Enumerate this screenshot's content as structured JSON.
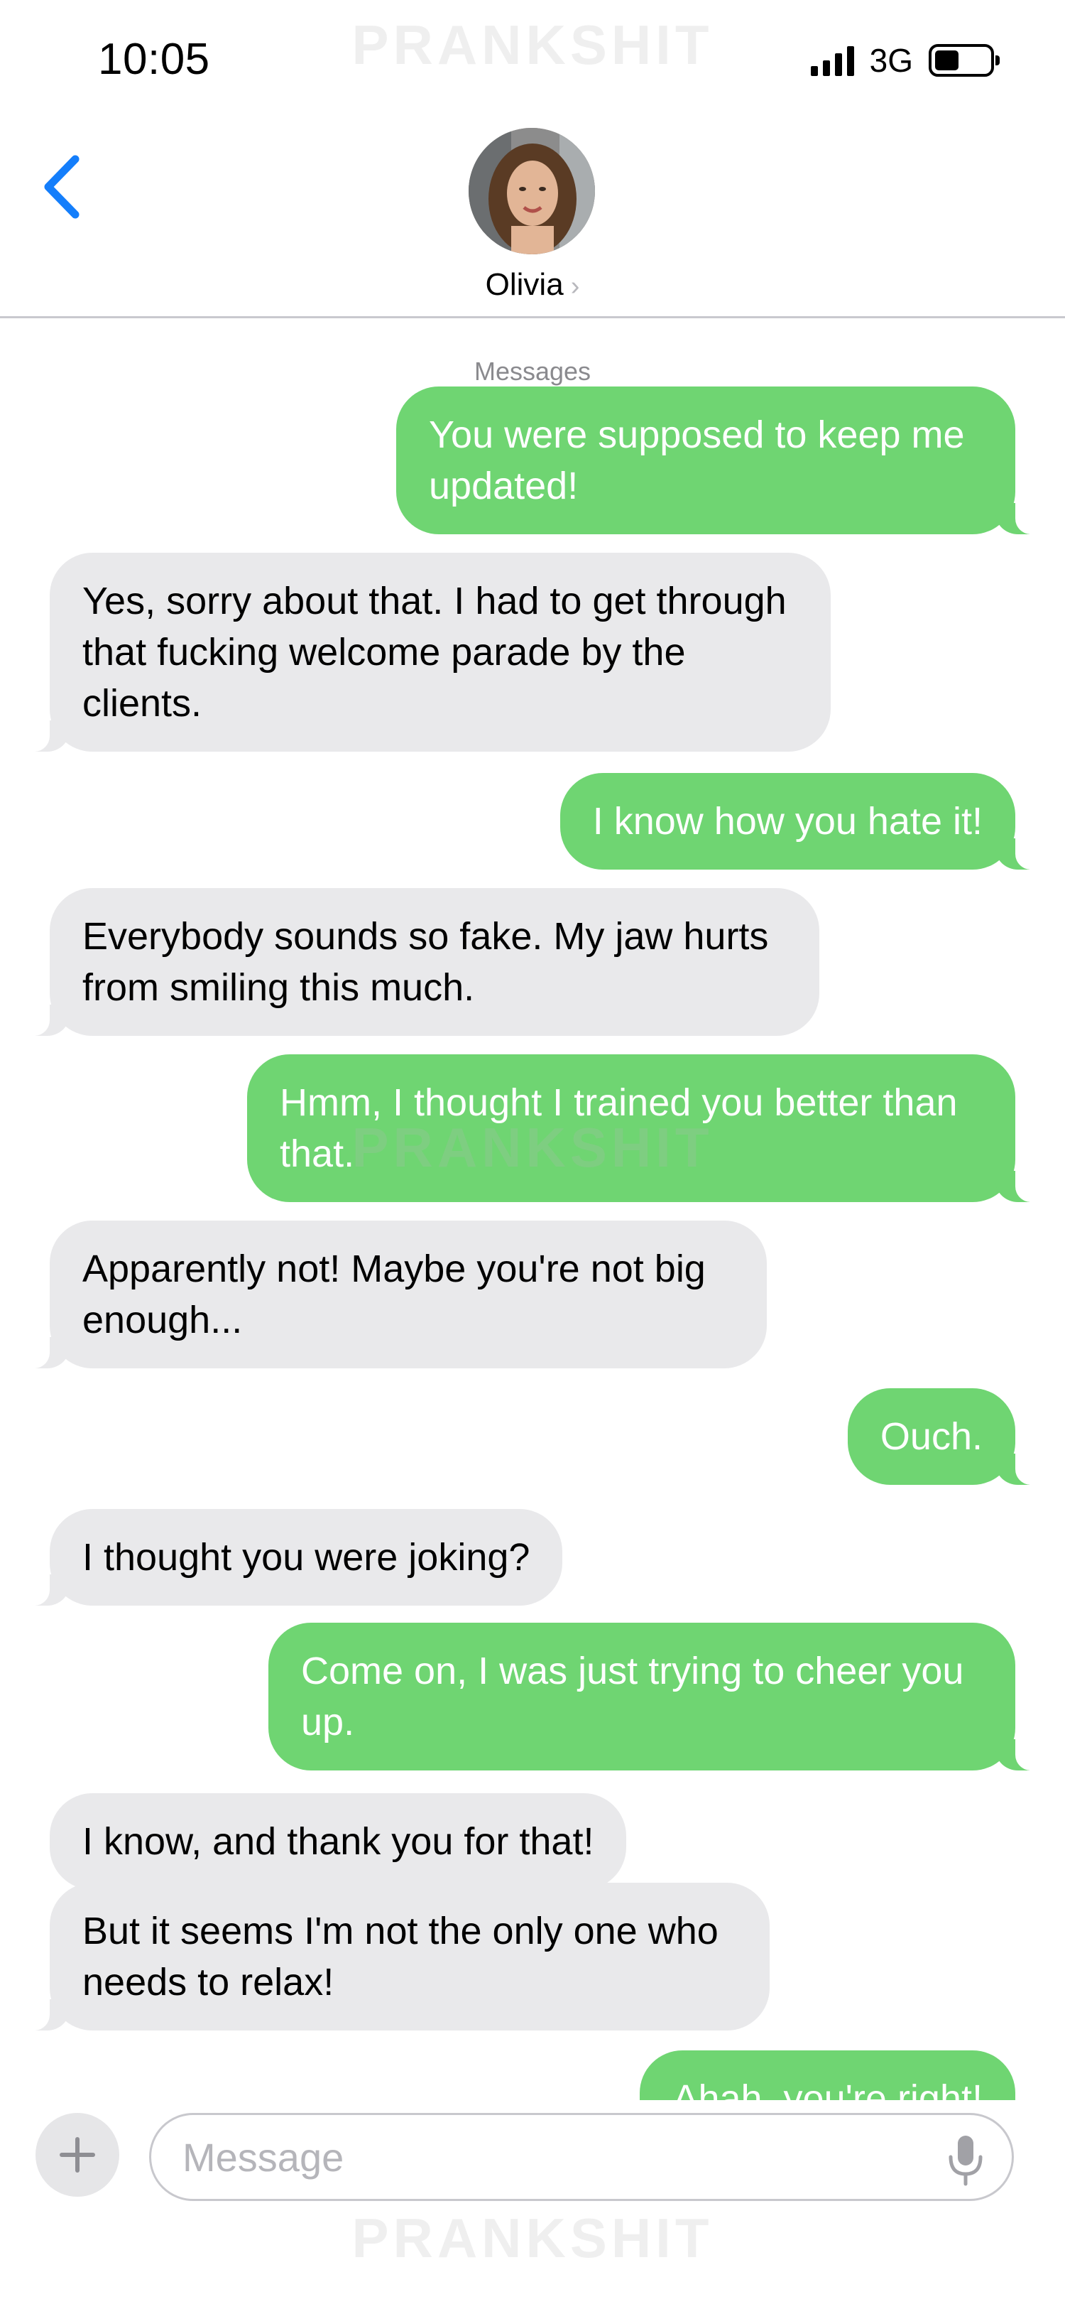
{
  "status_bar": {
    "time": "10:05",
    "network": "3G",
    "battery_level": 0.44
  },
  "watermark": "PRANKSHIT",
  "header": {
    "contact_name": "Olivia",
    "back_icon": "chevron-left-icon",
    "name_chevron": "›"
  },
  "chat": {
    "service_label": "Messages",
    "messages": [
      {
        "from": "me",
        "text": "You were supposed to keep me updated!"
      },
      {
        "from": "them",
        "text": "Yes, sorry about that. I had to get through that fucking welcome parade by the clients."
      },
      {
        "from": "me",
        "text": "I know how you hate it!"
      },
      {
        "from": "them",
        "text": "Everybody sounds so fake. My jaw hurts from smiling this much."
      },
      {
        "from": "me",
        "text": "Hmm, I thought I trained you better than that."
      },
      {
        "from": "them",
        "text": "Apparently not! Maybe you're not big enough..."
      },
      {
        "from": "me",
        "text": "Ouch."
      },
      {
        "from": "them",
        "text": "I thought you were joking?"
      },
      {
        "from": "me",
        "text": "Come on, I was just trying to cheer you up."
      },
      {
        "from": "them",
        "text": "I know, and thank you for that!"
      },
      {
        "from": "them",
        "text": "But it seems I'm not the only one who needs to relax!"
      },
      {
        "from": "me",
        "text": "Ahah, you're right!"
      }
    ]
  },
  "composer": {
    "placeholder": "Message",
    "plus_icon": "plus-icon",
    "mic_icon": "microphone-icon"
  },
  "colors": {
    "sent_bubble": "#6fd572",
    "received_bubble": "#e9e9eb",
    "accent": "#147efb"
  }
}
